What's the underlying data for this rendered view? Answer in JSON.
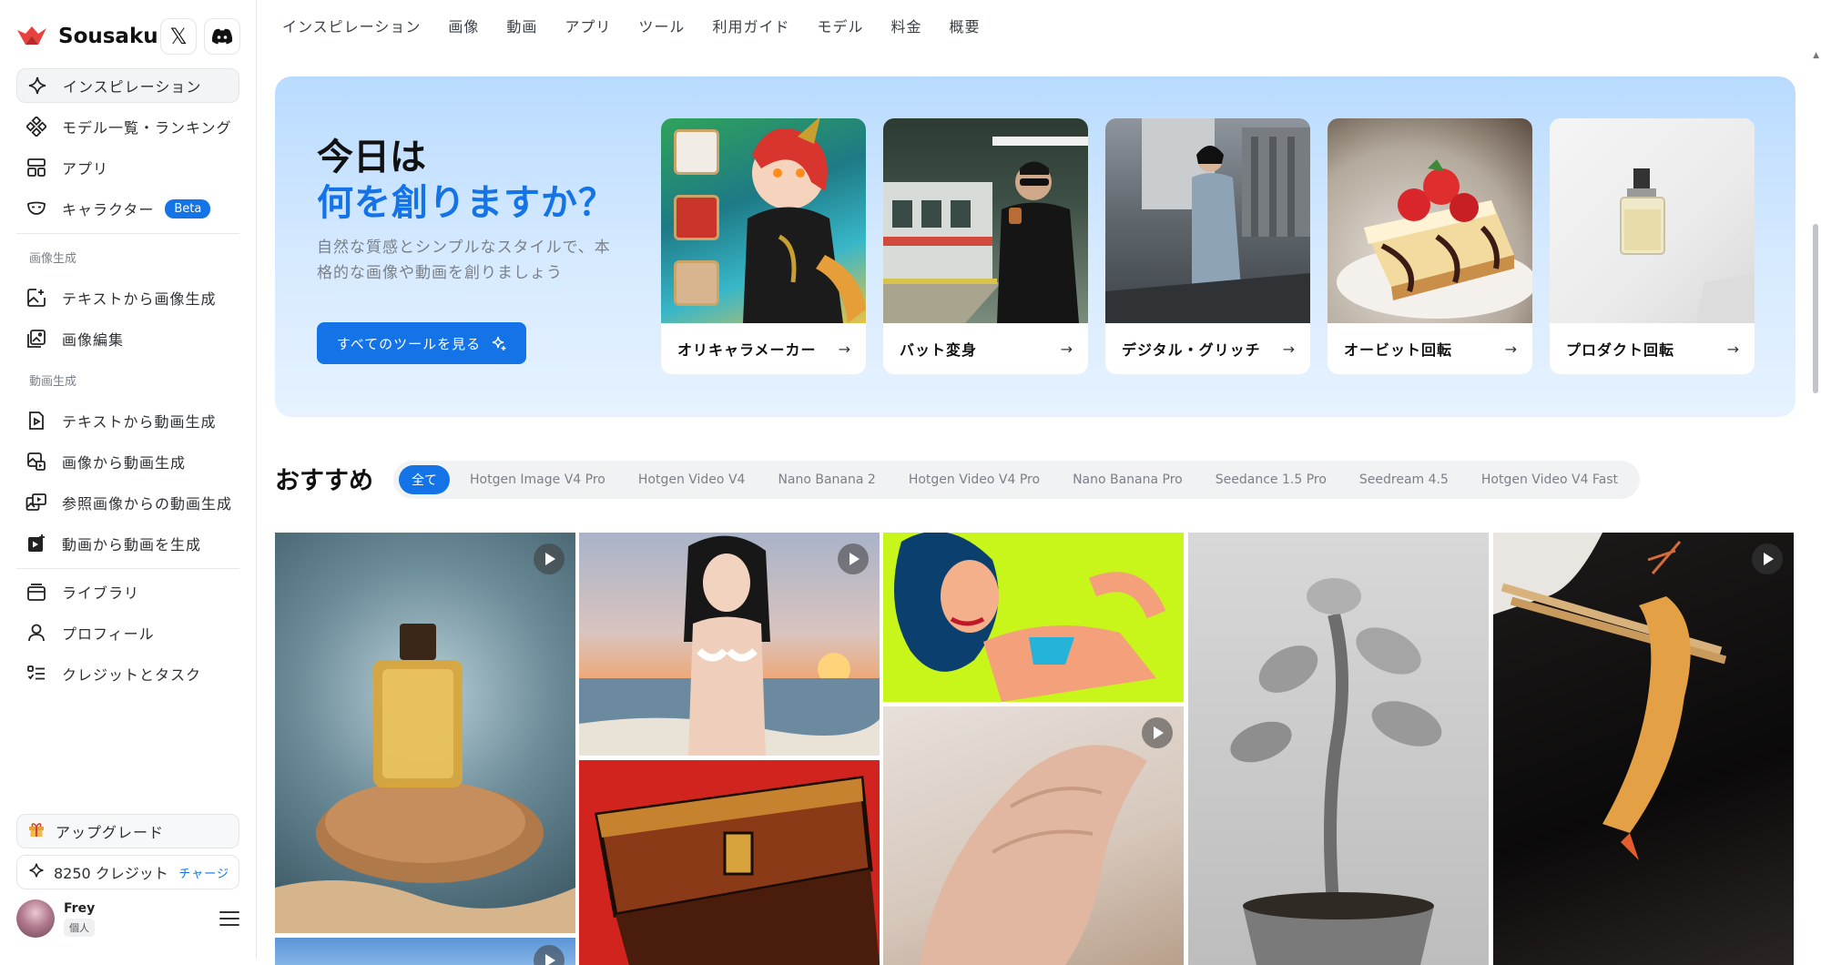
{
  "brand": {
    "name": "Sousaku"
  },
  "social": {
    "x_glyph": "𝕏"
  },
  "sidebar": {
    "main_items": [
      {
        "label": "インスピレーション",
        "icon": "sparkle-icon"
      },
      {
        "label": "モデル一覧・ランキング",
        "icon": "model-grid-icon"
      },
      {
        "label": "アプリ",
        "icon": "apps-icon"
      },
      {
        "label": "キャラクター",
        "icon": "mask-icon",
        "badge": "Beta"
      }
    ],
    "group_image": "画像生成",
    "image_items": [
      {
        "label": "テキストから画像生成",
        "icon": "text-to-image-icon"
      },
      {
        "label": "画像編集",
        "icon": "image-edit-icon"
      }
    ],
    "group_video": "動画生成",
    "video_items": [
      {
        "label": "テキストから動画生成",
        "icon": "text-to-video-icon"
      },
      {
        "label": "画像から動画生成",
        "icon": "image-to-video-icon"
      },
      {
        "label": "参照画像からの動画生成",
        "icon": "reference-video-icon"
      },
      {
        "label": "動画から動画を生成",
        "icon": "video-to-video-icon"
      }
    ],
    "account_items": [
      {
        "label": "ライブラリ",
        "icon": "library-icon"
      },
      {
        "label": "プロフィール",
        "icon": "profile-icon"
      },
      {
        "label": "クレジットとタスク",
        "icon": "tasks-icon"
      }
    ],
    "upgrade_label": "アップグレード",
    "credits_label": "8250 クレジット",
    "charge_label": "チャージ",
    "user_name": "Frey",
    "user_plan": "個人"
  },
  "topnav": [
    "インスピレーション",
    "画像",
    "動画",
    "アプリ",
    "ツール",
    "利用ガイド",
    "モデル",
    "料金",
    "概要"
  ],
  "hero": {
    "title_line1": "今日は",
    "title_line2": "何を創りますか？",
    "description": "自然な質感とシンプルなスタイルで、本格的な画像や動画を創りましょう",
    "button_label": "すべてのツールを見る",
    "cards": [
      {
        "label": "オリキャラメーカー"
      },
      {
        "label": "バット変身"
      },
      {
        "label": "デジタル・グリッチ"
      },
      {
        "label": "オービット回転"
      },
      {
        "label": "プロダクト回転"
      }
    ]
  },
  "recommended": {
    "title": "おすすめ",
    "chips": [
      "全て",
      "Hotgen Image V4 Pro",
      "Hotgen Video V4",
      "Nano Banana 2",
      "Hotgen Video V4 Pro",
      "Nano Banana Pro",
      "Seedance 1.5 Pro",
      "Seedream 4.5",
      "Hotgen Video V4 Fast"
    ],
    "active_chip": "全て"
  },
  "colors": {
    "accent": "#1473e6",
    "hero_bg": "#c9e3ff"
  }
}
